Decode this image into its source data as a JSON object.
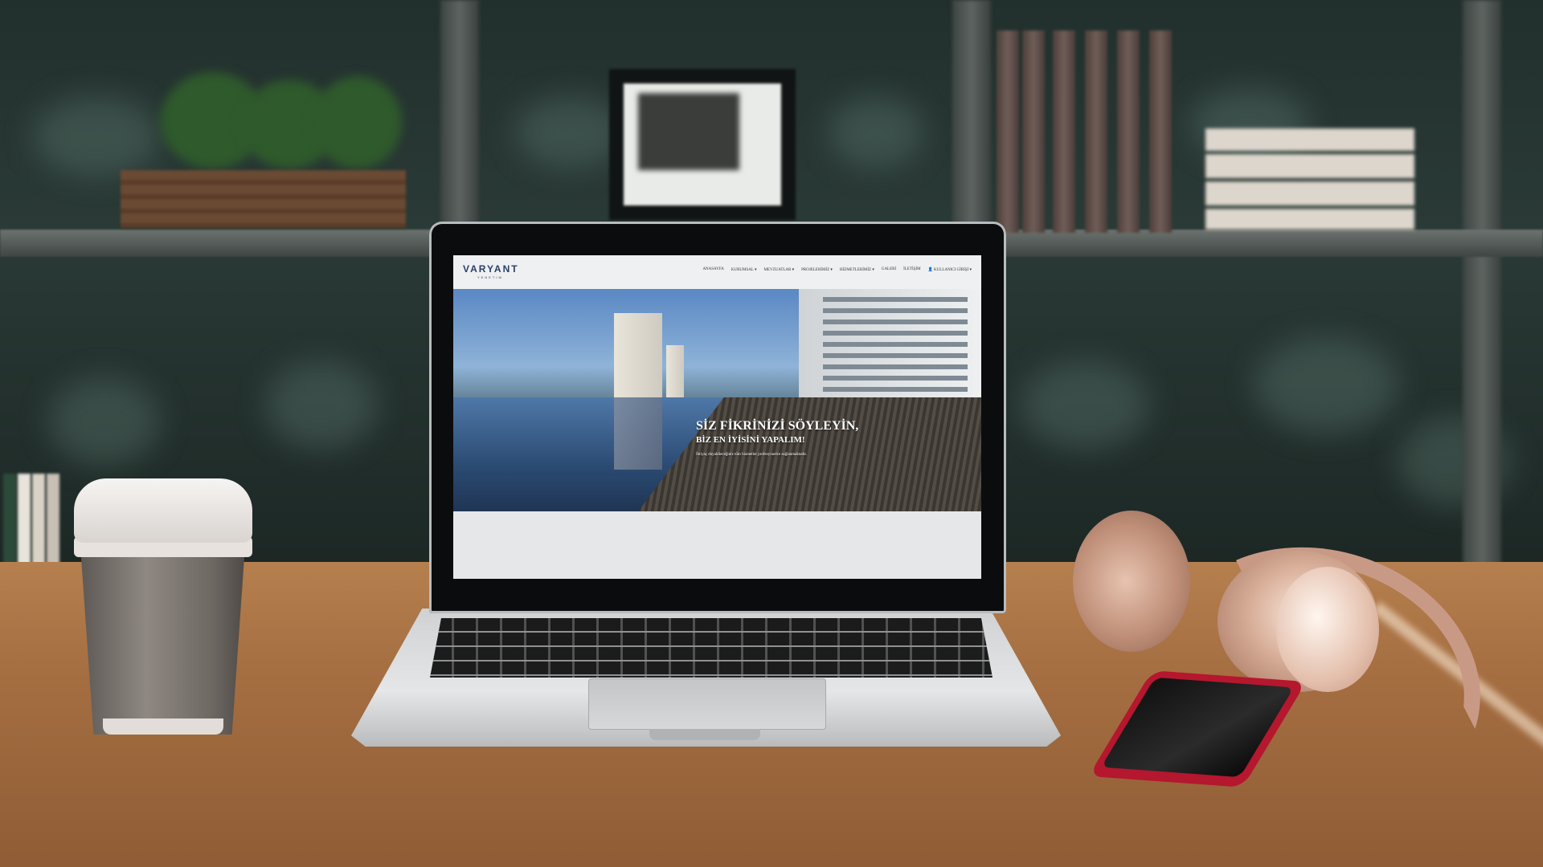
{
  "laptop_screen": {
    "site": {
      "logo": "VARYANT",
      "logo_sub": "YENETİM",
      "nav": [
        "ANASAYFA",
        "KURUMSAL ▾",
        "MEVZUATLAR ▾",
        "PROJELERİMİZ ▾",
        "HİZMETLERİMİZ ▾",
        "GALERİ",
        "İLETİŞİM",
        "👤 KULLANICI GİRİŞİ ▾"
      ],
      "hero_title": "SİZ FİKRİNİZİ SÖYLEYİN,",
      "hero_subtitle": "BİZ EN İYİSİNİ YAPALIM!",
      "hero_text": "İhtiyaç duyabileceğiniz tüm hizmetler profesyonelce sağlanmaktadır."
    }
  },
  "colors": {
    "desk": "#a66f42",
    "wall": "#22302d",
    "laptop_silver": "#d8dadc",
    "headphones": "#c89a86",
    "phone": "#b5172e",
    "logo_blue": "#2b3f6b"
  },
  "objects": [
    "coffee-cup",
    "laptop",
    "headphones",
    "smartphone",
    "bookshelf",
    "picture-frame",
    "plant"
  ]
}
